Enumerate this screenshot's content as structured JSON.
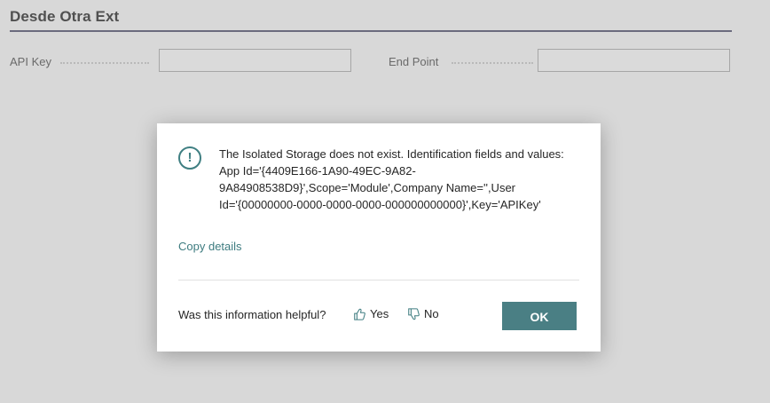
{
  "page": {
    "section_title": "Desde Otra Ext",
    "fields": [
      {
        "label": "API Key",
        "value": ""
      },
      {
        "label": "End Point",
        "value": ""
      }
    ]
  },
  "dialog": {
    "icon": "info-icon",
    "icon_glyph": "!",
    "message": "The Isolated Storage does not exist. Identification fields and values: App Id='{4409E166-1A90-49EC-9A82-9A84908538D9}',Scope='Module',Company Name='',User Id='{00000000-0000-0000-0000-000000000000}',Key='APIKey'",
    "copy_details": "Copy details",
    "feedback_question": "Was this information helpful?",
    "yes_label": "Yes",
    "no_label": "No",
    "ok_label": "OK"
  },
  "colors": {
    "accent": "#4a7f84",
    "link": "#3e7c80",
    "overlay_background": "#d8d8d8"
  }
}
